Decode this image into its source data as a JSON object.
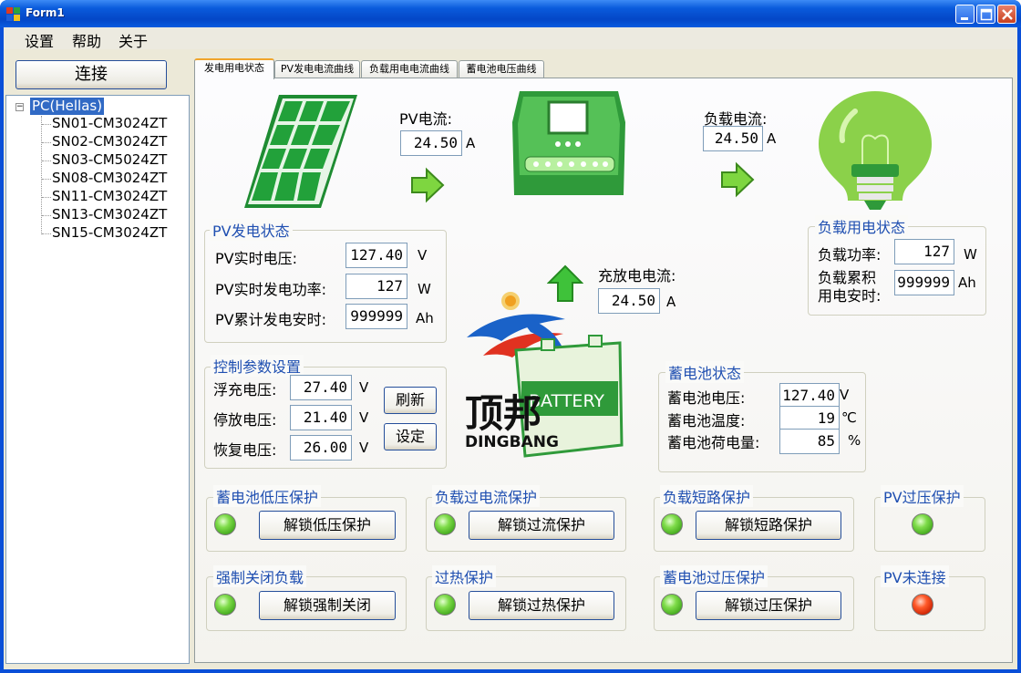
{
  "window": {
    "title": "Form1"
  },
  "menu": [
    "设置",
    "帮助",
    "关于"
  ],
  "sidebar": {
    "connect_label": "连接",
    "root_toggle": "−",
    "root_label": "PC(Hellas)",
    "items": [
      "SN01-CM3024ZT",
      "SN02-CM3024ZT",
      "SN03-CM5024ZT",
      "SN08-CM3024ZT",
      "SN11-CM3024ZT",
      "SN13-CM3024ZT",
      "SN15-CM3024ZT"
    ]
  },
  "tabs": [
    "发电用电状态",
    "PV发电电流曲线",
    "负载用电电流曲线",
    "蓄电池电压曲线"
  ],
  "flow": {
    "pv_current_label": "PV电流:",
    "pv_current_value": "24.50",
    "load_current_label": "负载电流:",
    "load_current_value": "24.50",
    "charge_current_label": "充放电电流:",
    "charge_current_value": "24.50",
    "unit_a": "A"
  },
  "pv_status": {
    "title": "PV发电状态",
    "voltage_label": "PV实时电压:",
    "voltage_value": "127.40",
    "voltage_unit": "V",
    "power_label": "PV实时发电功率:",
    "power_value": "127",
    "power_unit": "W",
    "ah_label": "PV累计发电安时:",
    "ah_value": "999999",
    "ah_unit": "Ah"
  },
  "load_status": {
    "title": "负载用电状态",
    "power_label": "负载功率:",
    "power_value": "127",
    "power_unit": "W",
    "ah_label_1": "负载累积",
    "ah_label_2": "用电安时:",
    "ah_value": "999999",
    "ah_unit": "Ah"
  },
  "control": {
    "title": "控制参数设置",
    "float_label": "浮充电压:",
    "float_value": "27.40",
    "stop_label": "停放电压:",
    "stop_value": "21.40",
    "recover_label": "恢复电压:",
    "recover_value": "26.00",
    "unit_v": "V",
    "refresh_label": "刷新",
    "set_label": "设定"
  },
  "battery": {
    "title": "蓄电池状态",
    "voltage_label": "蓄电池电压:",
    "voltage_value": "127.40",
    "voltage_unit": "V",
    "temp_label": "蓄电池温度:",
    "temp_value": "19",
    "temp_unit": "℃",
    "charge_label": "蓄电池荷电量:",
    "charge_value": "85",
    "charge_unit": "%",
    "box_text": "BATTERY"
  },
  "logo": {
    "cn": "顶邦",
    "en": "DINGBANG"
  },
  "protections": [
    {
      "title": "蓄电池低压保护",
      "button": "解锁低压保护",
      "led": "green"
    },
    {
      "title": "负载过电流保护",
      "button": "解锁过流保护",
      "led": "green"
    },
    {
      "title": "负载短路保护",
      "button": "解锁短路保护",
      "led": "green"
    },
    {
      "title": "PV过压保护",
      "led": "green"
    },
    {
      "title": "强制关闭负载",
      "button": "解锁强制关闭",
      "led": "green"
    },
    {
      "title": "过热保护",
      "button": "解锁过热保护",
      "led": "green"
    },
    {
      "title": "蓄电池过压保护",
      "button": "解锁过压保护",
      "led": "green"
    },
    {
      "title": "PV未连接",
      "led": "red"
    }
  ],
  "colors": {
    "led_green": "#4caf20",
    "led_red": "#e03010",
    "accent_blue": "#1f4fb1",
    "device_green": "#2f9a3a"
  }
}
